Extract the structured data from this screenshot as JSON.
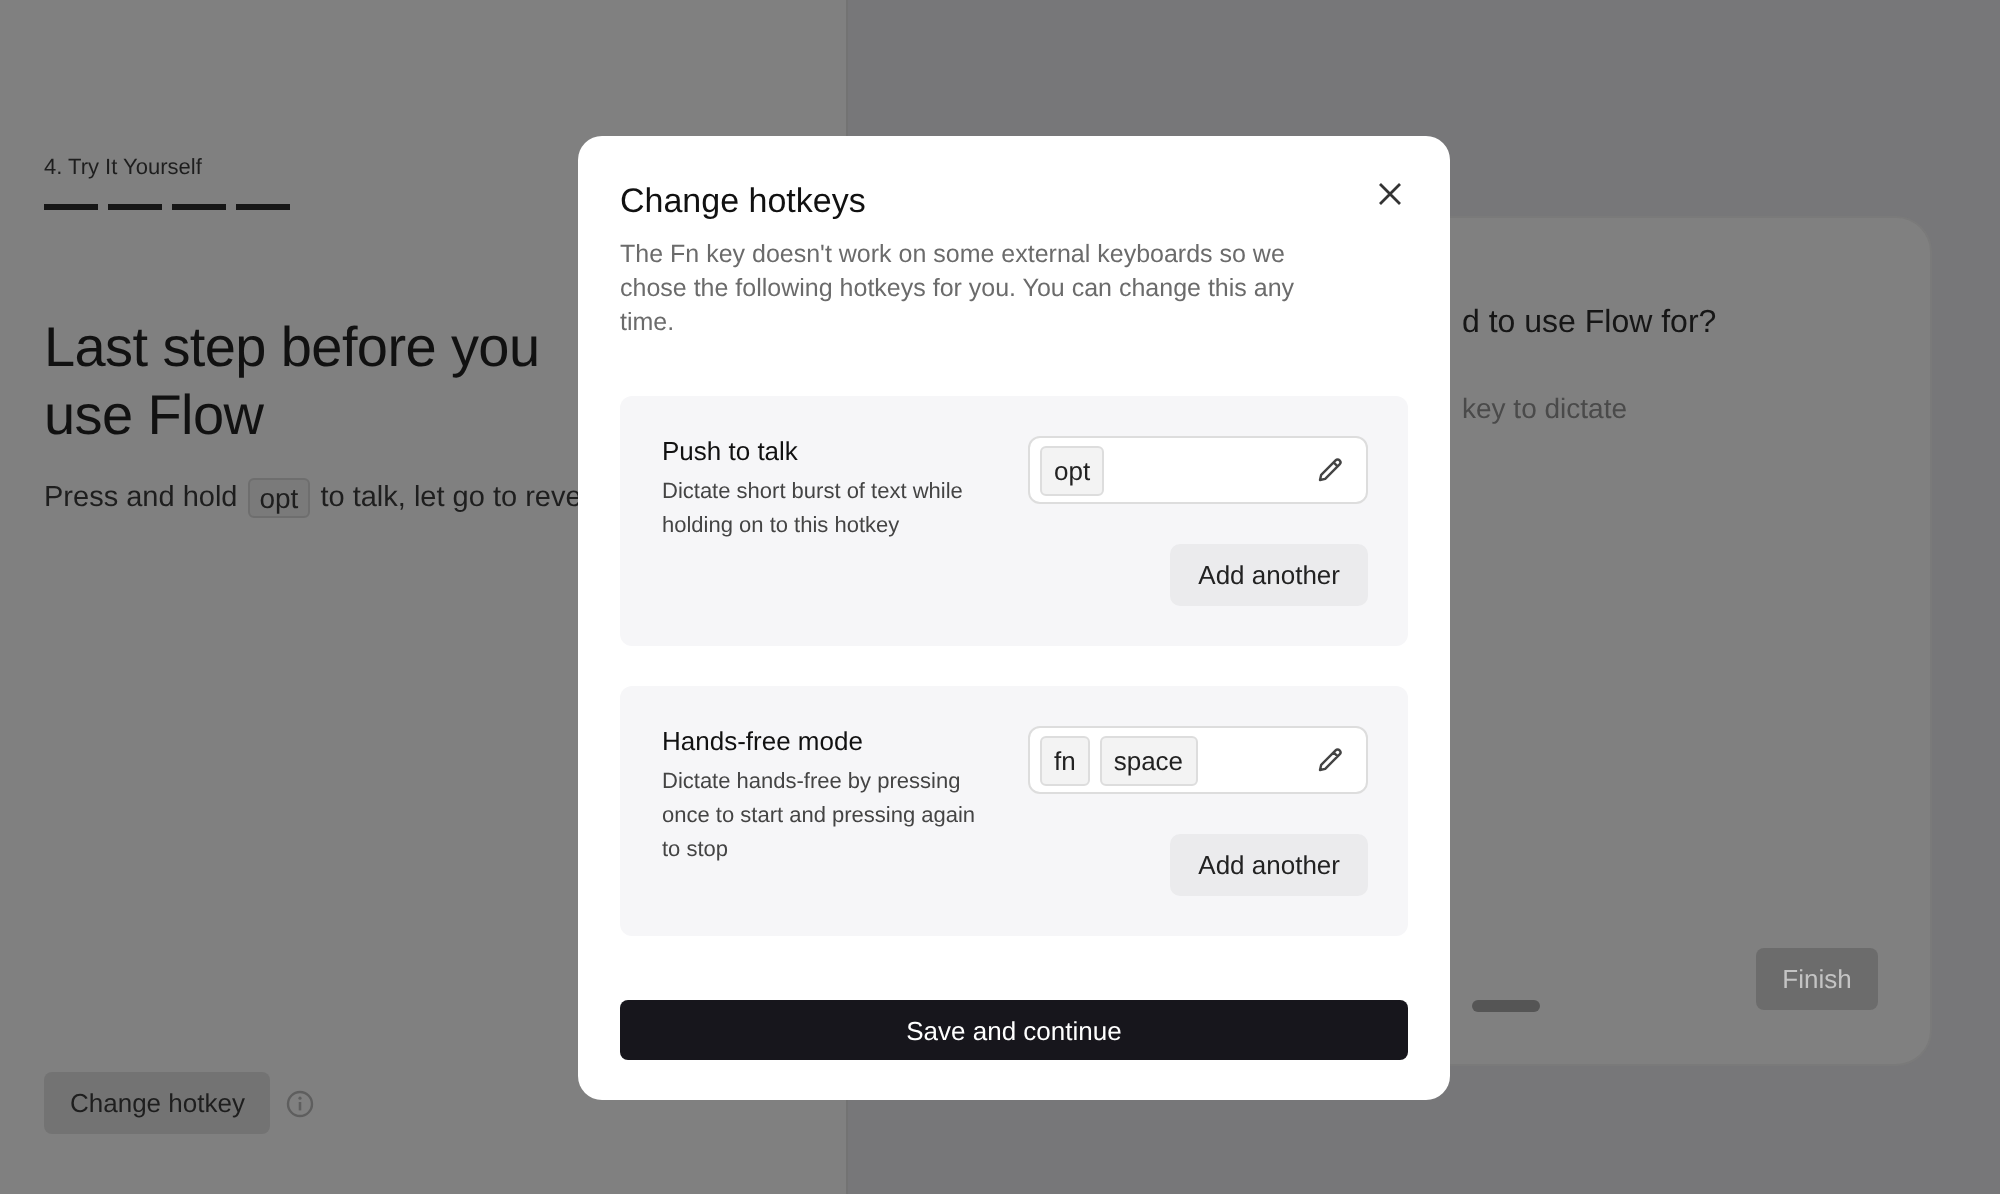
{
  "page": {
    "step_label": "4. Try It Yourself",
    "progress": [
      {
        "done": true
      },
      {
        "done": true
      },
      {
        "done": true
      },
      {
        "done": true
      }
    ],
    "headline": [
      "Last step before you",
      "use Flow"
    ],
    "instruction": {
      "before": "Press and hold",
      "key": "opt",
      "after": "to talk, let go to reve"
    },
    "change_hotkey_button": "Change hotkey"
  },
  "card": {
    "question": "d to use Flow for?",
    "placeholder": "key to dictate",
    "finish_button": {
      "label": "Finish",
      "disabled": true
    }
  },
  "modal": {
    "title": "Change hotkeys",
    "description": "The Fn key doesn't work on some external keyboards so we chose the following hotkeys for you. You can change this any time.",
    "sections": [
      {
        "title": "Push to talk",
        "description": "Dictate short burst of text while holding on to this hotkey",
        "keys": [
          "opt"
        ],
        "add_button": "Add another"
      },
      {
        "title": "Hands-free mode",
        "description": "Dictate hands-free by pressing once to start and pressing again to stop",
        "keys": [
          "fn",
          "space"
        ],
        "add_button": "Add another"
      }
    ],
    "primary_button": "Save and continue"
  }
}
